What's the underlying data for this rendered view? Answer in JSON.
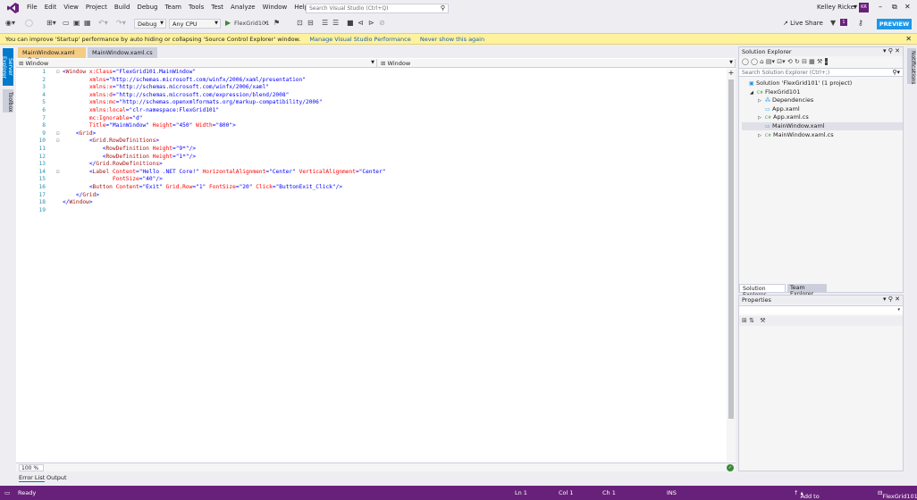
{
  "menu": [
    "File",
    "Edit",
    "View",
    "Project",
    "Build",
    "Debug",
    "Team",
    "Tools",
    "Test",
    "Analyze",
    "Window",
    "Help"
  ],
  "search": {
    "placeholder": "Search Visual Studio (Ctrl+Q)"
  },
  "user": {
    "name": "Kelley Ricker",
    "initials": "KR"
  },
  "toolbar": {
    "config": "Debug",
    "platform": "Any CPU",
    "run_target": "FlexGrid101",
    "live_share": "Live Share",
    "notifications_count": "1",
    "preview": "PREVIEW"
  },
  "infobar": {
    "message": "You can improve 'Startup' performance by auto hiding or collapsing 'Source Control Explorer' window.",
    "link1": "Manage Visual Studio Performance",
    "link2": "Never show this again"
  },
  "left_strip": [
    "Server Explorer",
    "Toolbox"
  ],
  "right_strip": [
    "Notifications"
  ],
  "editor": {
    "tabs": [
      {
        "label": "MainWindow.xaml",
        "active": true
      },
      {
        "label": "MainWindow.xaml.cs",
        "active": false
      }
    ],
    "nav_left": "Window",
    "nav_right": "Window",
    "zoom": "100 %",
    "lines": [
      {
        "n": "1",
        "fold": "⊟",
        "code": "<Window x:Class=\"FlexGrid101.MainWindow\""
      },
      {
        "n": "2",
        "fold": "",
        "code": "        xmlns=\"http://schemas.microsoft.com/winfx/2006/xaml/presentation\""
      },
      {
        "n": "3",
        "fold": "",
        "code": "        xmlns:x=\"http://schemas.microsoft.com/winfx/2006/xaml\""
      },
      {
        "n": "4",
        "fold": "",
        "code": "        xmlns:d=\"http://schemas.microsoft.com/expression/blend/2008\""
      },
      {
        "n": "5",
        "fold": "",
        "code": "        xmlns:mc=\"http://schemas.openxmlformats.org/markup-compatibility/2006\""
      },
      {
        "n": "6",
        "fold": "",
        "code": "        xmlns:local=\"clr-namespace:FlexGrid101\""
      },
      {
        "n": "7",
        "fold": "",
        "code": "        mc:Ignorable=\"d\""
      },
      {
        "n": "8",
        "fold": "",
        "code": "        Title=\"MainWindow\" Height=\"450\" Width=\"800\">"
      },
      {
        "n": "9",
        "fold": "⊟",
        "code": "    <Grid>"
      },
      {
        "n": "10",
        "fold": "⊟",
        "code": "        <Grid.RowDefinitions>"
      },
      {
        "n": "11",
        "fold": "",
        "code": "            <RowDefinition Height=\"9*\"/>"
      },
      {
        "n": "12",
        "fold": "",
        "code": "            <RowDefinition Height=\"1*\"/>"
      },
      {
        "n": "13",
        "fold": "",
        "code": "        </Grid.RowDefinitions>"
      },
      {
        "n": "14",
        "fold": "⊟",
        "code": "        <Label Content=\"Hello .NET Core!\" HorizontalAlignment=\"Center\" VerticalAlignment=\"Center\""
      },
      {
        "n": "15",
        "fold": "",
        "code": "               FontSize=\"40\"/>"
      },
      {
        "n": "16",
        "fold": "",
        "code": "        <Button Content=\"Exit\" Grid.Row=\"1\" FontSize=\"20\" Click=\"ButtonExit_Click\"/>"
      },
      {
        "n": "17",
        "fold": "",
        "code": "    </Grid>"
      },
      {
        "n": "18",
        "fold": "",
        "code": "</Window>"
      },
      {
        "n": "19",
        "fold": "",
        "code": ""
      }
    ]
  },
  "solution_explorer": {
    "title": "Solution Explorer",
    "search_placeholder": "Search Solution Explorer (Ctrl+;)",
    "items": [
      {
        "label": "Solution 'FlexGrid101' (1 project)",
        "indent": 0,
        "icon": "solution-icon",
        "arrow": ""
      },
      {
        "label": "FlexGrid101",
        "indent": 1,
        "icon": "csharp-project-icon",
        "arrow": "◢"
      },
      {
        "label": "Dependencies",
        "indent": 2,
        "icon": "dependencies-icon",
        "arrow": "▷"
      },
      {
        "label": "App.xaml",
        "indent": 2,
        "icon": "xaml-file-icon",
        "arrow": ""
      },
      {
        "label": "App.xaml.cs",
        "indent": 2,
        "icon": "csharp-file-icon",
        "arrow": "▷"
      },
      {
        "label": "MainWindow.xaml",
        "indent": 2,
        "icon": "xaml-file-icon",
        "arrow": "",
        "selected": true
      },
      {
        "label": "MainWindow.xaml.cs",
        "indent": 2,
        "icon": "csharp-file-icon",
        "arrow": "▷"
      }
    ],
    "tabs": [
      "Solution Explorer",
      "Team Explorer"
    ]
  },
  "properties": {
    "title": "Properties"
  },
  "output_tabs": [
    "Error List",
    "Output"
  ],
  "status": {
    "left": "Ready",
    "ln": "Ln 1",
    "col": "Col 1",
    "ch": "Ch 1",
    "mode": "INS",
    "source_control": "Add to Source Control",
    "project": "FlexGrid101"
  },
  "colors": {
    "accent": "#68217a",
    "preview": "#1c97ea",
    "active_tab": "#f5cc84"
  }
}
